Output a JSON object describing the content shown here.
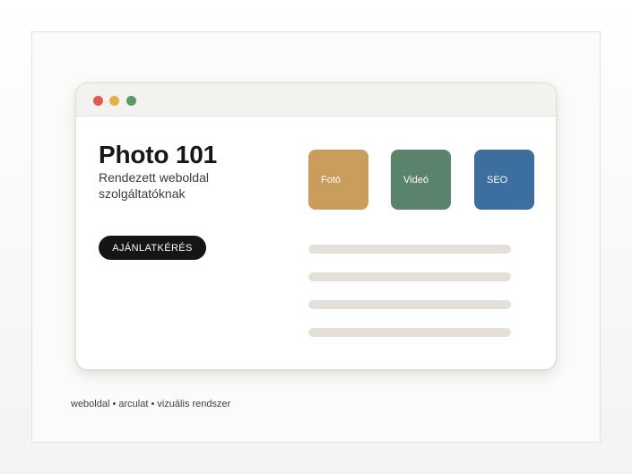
{
  "window": {
    "controls": [
      {
        "name": "close",
        "color": "#e05a50"
      },
      {
        "name": "minimize",
        "color": "#e0b04a"
      },
      {
        "name": "maximize",
        "color": "#5a9a6a"
      }
    ]
  },
  "hero": {
    "title": "Photo 101",
    "subtitle": "Rendezett weboldal szolgáltatóknak",
    "cta_label": "AJÁNLATKÉRÉS"
  },
  "tiles": [
    {
      "label": "Fotó",
      "color": "#c99d5c"
    },
    {
      "label": "Videó",
      "color": "#5b836b"
    },
    {
      "label": "SEO",
      "color": "#3d6ea0"
    }
  ],
  "placeholder_lines": 4,
  "caption": "weboldal • arculat • vizuális rendszer"
}
